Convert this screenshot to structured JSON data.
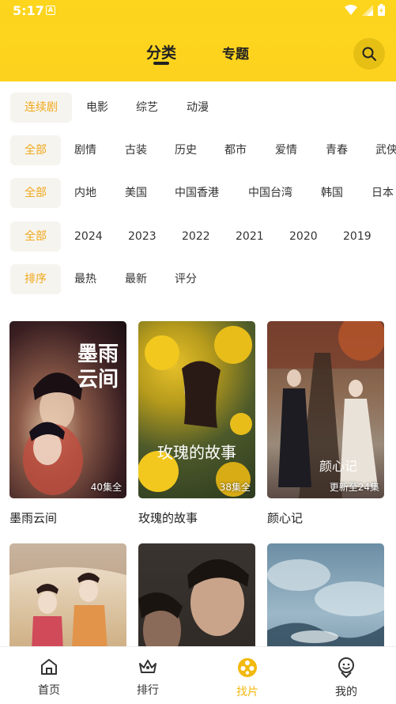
{
  "status_bar": {
    "time": "5:17",
    "notification_letter": "A"
  },
  "header": {
    "tabs": [
      {
        "label": "分类",
        "active": true
      },
      {
        "label": "专题",
        "active": false
      }
    ],
    "accent_color": "#fdd51d"
  },
  "filters": {
    "type_row": [
      "连续剧",
      "电影",
      "综艺",
      "动漫"
    ],
    "genre_row": [
      "全部",
      "剧情",
      "古装",
      "历史",
      "都市",
      "爱情",
      "青春",
      "武侠"
    ],
    "region_row": [
      "全部",
      "内地",
      "美国",
      "中国香港",
      "中国台湾",
      "韩国",
      "日本"
    ],
    "year_row": [
      "全部",
      "2024",
      "2023",
      "2022",
      "2021",
      "2020",
      "2019"
    ],
    "sort_row": [
      "排序",
      "最热",
      "最新",
      "评分"
    ],
    "active_color": "#f0a81a"
  },
  "grid": {
    "items": [
      {
        "title": "墨雨云间",
        "badge": "40集全",
        "poster_text": "墨雨\n云间"
      },
      {
        "title": "玫瑰的故事",
        "badge": "38集全",
        "poster_text": "玫瑰的故事"
      },
      {
        "title": "颜心记",
        "badge": "更新至24集",
        "poster_text": "颜心记"
      },
      {
        "title": "",
        "badge": "",
        "poster_text": ""
      },
      {
        "title": "",
        "badge": "",
        "poster_text": ""
      },
      {
        "title": "",
        "badge": "",
        "poster_text": ""
      }
    ]
  },
  "bottom_nav": {
    "items": [
      {
        "label": "首页",
        "icon": "home-icon"
      },
      {
        "label": "排行",
        "icon": "crown-icon"
      },
      {
        "label": "找片",
        "icon": "film-reel-icon",
        "active": true
      },
      {
        "label": "我的",
        "icon": "profile-icon"
      }
    ]
  }
}
